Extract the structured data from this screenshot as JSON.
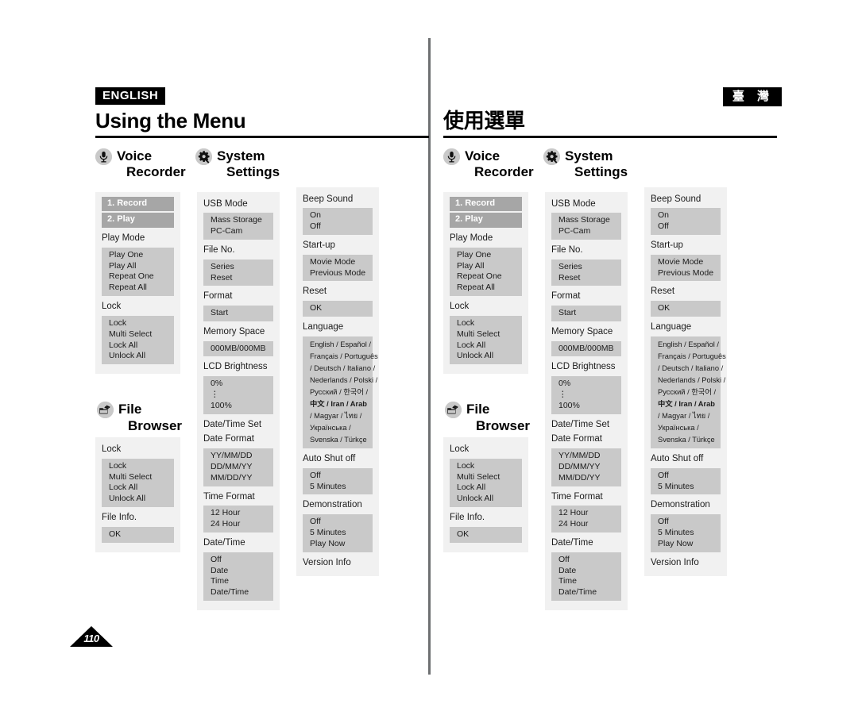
{
  "page": {
    "number": "110"
  },
  "left": {
    "lang_tag": "ENGLISH",
    "title": "Using the Menu"
  },
  "right": {
    "lang_tag": "臺 灣",
    "title": "使用選單"
  },
  "headings": {
    "voice_recorder": {
      "line1": "Voice",
      "line2": "Recorder",
      "icon": "microphone-icon"
    },
    "system_settings": {
      "line1": "System",
      "line2": "Settings",
      "icon": "gear-icon"
    },
    "file_browser": {
      "line1": "File",
      "line2": "Browser",
      "icon": "folder-stack-icon"
    }
  },
  "voice_recorder": {
    "bars": [
      "1. Record",
      "2. Play"
    ],
    "groups": [
      {
        "label": "Play Mode",
        "options": [
          "Play One",
          "Play All",
          "Repeat One",
          "Repeat All"
        ]
      },
      {
        "label": "Lock",
        "options": [
          "Lock",
          "Multi Select",
          "Lock All",
          "Unlock All"
        ]
      }
    ]
  },
  "file_browser": {
    "groups": [
      {
        "label": "Lock",
        "options": [
          "Lock",
          "Multi Select",
          "Lock All",
          "Unlock All"
        ]
      },
      {
        "label": "File Info.",
        "options": [
          "OK"
        ]
      }
    ]
  },
  "system_settings_col1": {
    "groups": [
      {
        "label": "USB Mode",
        "options": [
          "Mass Storage",
          "PC-Cam"
        ]
      },
      {
        "label": "File No.",
        "options": [
          "Series",
          "Reset"
        ]
      },
      {
        "label": "Format",
        "options": [
          "Start"
        ]
      },
      {
        "label": "Memory Space",
        "options": [
          "000MB/000MB"
        ]
      },
      {
        "label": "LCD Brightness",
        "options": [
          "0%",
          "⋮",
          "100%"
        ]
      },
      {
        "label": "Date/Time Set",
        "label2": "Date Format",
        "options": [
          "YY/MM/DD",
          "DD/MM/YY",
          "MM/DD/YY"
        ]
      },
      {
        "label": "Time Format",
        "options": [
          "12 Hour",
          "24 Hour"
        ]
      },
      {
        "label": "Date/Time",
        "options": [
          "Off",
          "Date",
          "Time",
          "Date/Time"
        ]
      }
    ]
  },
  "system_settings_col2": {
    "groups": [
      {
        "label": "Beep Sound",
        "options": [
          "On",
          "Off"
        ]
      },
      {
        "label": "Start-up",
        "options": [
          "Movie Mode",
          "Previous Mode"
        ]
      },
      {
        "label": "Reset",
        "options": [
          "OK"
        ]
      },
      {
        "label": "Language",
        "options": [
          "English / Español /",
          "Français / Português",
          "/ Deutsch / Italiano /",
          "Nederlands / Polski /",
          "Русский / 한국어 /",
          "中文 / Iran / Arab",
          "/ Magyar / ไทย /",
          "Українська /",
          "Svenska / Türkçe"
        ]
      },
      {
        "label": "Auto Shut off",
        "options": [
          "Off",
          "5 Minutes"
        ]
      },
      {
        "label": "Demonstration",
        "options": [
          "Off",
          "5 Minutes",
          "Play Now"
        ]
      },
      {
        "label": "Version Info",
        "options": []
      }
    ]
  }
}
